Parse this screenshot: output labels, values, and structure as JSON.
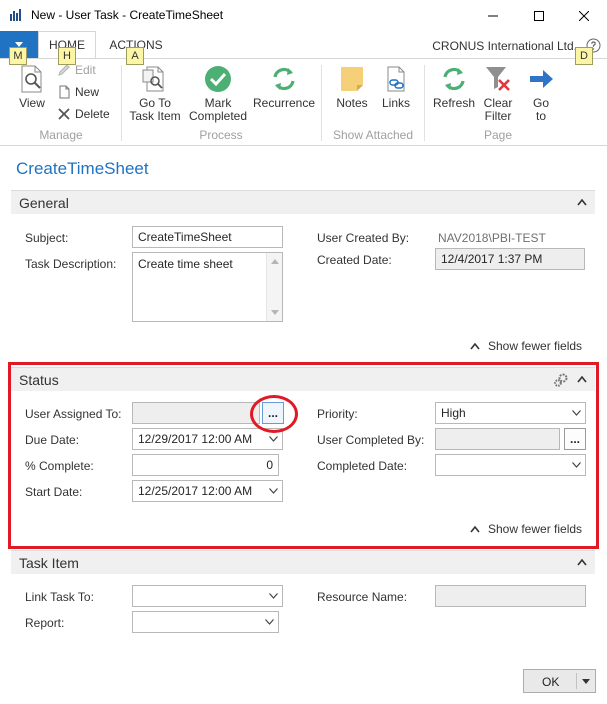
{
  "window": {
    "title": "New - User Task - CreateTimeSheet"
  },
  "ribbon_tabs": {
    "home": "HOME",
    "actions": "ACTIONS"
  },
  "company": "CRONUS International Ltd.",
  "keytips": {
    "file": "M",
    "home": "H",
    "actions": "A",
    "help": "D"
  },
  "ribbon": {
    "view": "View",
    "edit": "Edit",
    "new": "New",
    "delete": "Delete",
    "go_to_task_item_1": "Go To",
    "go_to_task_item_2": "Task Item",
    "mark_completed_1": "Mark",
    "mark_completed_2": "Completed",
    "recurrence": "Recurrence",
    "notes": "Notes",
    "links": "Links",
    "refresh": "Refresh",
    "clear_filter_1": "Clear",
    "clear_filter_2": "Filter",
    "go_to_1": "Go",
    "go_to_2": "to",
    "groups": {
      "manage": "Manage",
      "process": "Process",
      "show_attached": "Show Attached",
      "page": "Page"
    }
  },
  "page_title": "CreateTimeSheet",
  "general": {
    "header": "General",
    "subject_label": "Subject:",
    "subject_value": "CreateTimeSheet",
    "task_description_label": "Task Description:",
    "task_description_value": "Create time sheet",
    "user_created_by_label": "User Created By:",
    "user_created_by_value": "NAV2018\\PBI-TEST",
    "created_date_label": "Created Date:",
    "created_date_value": "12/4/2017 1:37 PM",
    "show_fewer": "Show fewer fields"
  },
  "status": {
    "header": "Status",
    "user_assigned_to_label": "User Assigned To:",
    "user_assigned_to_value": "",
    "due_date_label": "Due Date:",
    "due_date_value": "12/29/2017 12:00 AM",
    "percent_complete_label": "% Complete:",
    "percent_complete_value": "0",
    "start_date_label": "Start Date:",
    "start_date_value": "12/25/2017 12:00 AM",
    "priority_label": "Priority:",
    "priority_value": "High",
    "user_completed_by_label": "User Completed By:",
    "user_completed_by_value": "",
    "completed_date_label": "Completed Date:",
    "completed_date_value": "",
    "lookup_label": "...",
    "show_fewer": "Show fewer fields"
  },
  "task_item": {
    "header": "Task Item",
    "link_task_to_label": "Link Task To:",
    "link_task_to_value": "",
    "report_label": "Report:",
    "report_value": "",
    "resource_name_label": "Resource Name:",
    "resource_name_value": ""
  },
  "footer": {
    "ok": "OK"
  },
  "colors": {
    "accent": "#1f73c2",
    "highlight": "#e01a25",
    "keytip": "#fdf5a6"
  }
}
